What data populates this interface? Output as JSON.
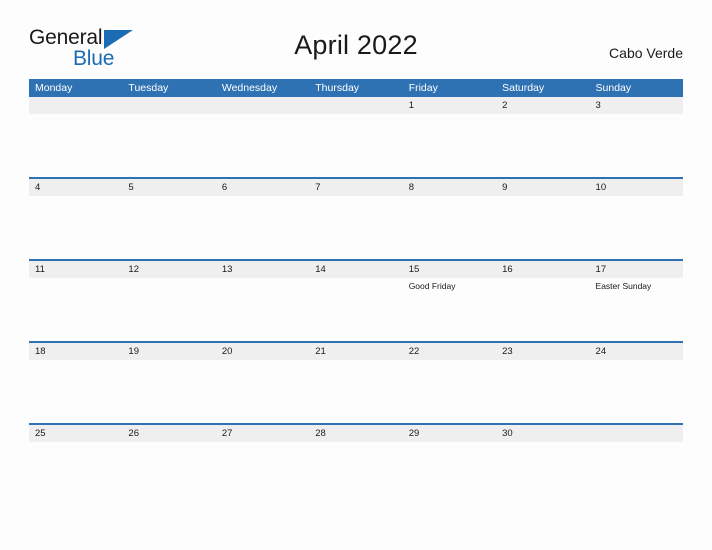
{
  "brand": {
    "name_part1": "General",
    "name_part2": "Blue",
    "triangle_icon": "triangle-icon"
  },
  "header": {
    "title": "April 2022",
    "country": "Cabo Verde"
  },
  "calendar": {
    "month": "April",
    "year": "2022",
    "accent_color": "#2e72b4",
    "band_color": "#efefef",
    "weekdays": [
      "Monday",
      "Tuesday",
      "Wednesday",
      "Thursday",
      "Friday",
      "Saturday",
      "Sunday"
    ],
    "weeks": [
      [
        {
          "date": "",
          "event": ""
        },
        {
          "date": "",
          "event": ""
        },
        {
          "date": "",
          "event": ""
        },
        {
          "date": "",
          "event": ""
        },
        {
          "date": "1",
          "event": ""
        },
        {
          "date": "2",
          "event": ""
        },
        {
          "date": "3",
          "event": ""
        }
      ],
      [
        {
          "date": "4",
          "event": ""
        },
        {
          "date": "5",
          "event": ""
        },
        {
          "date": "6",
          "event": ""
        },
        {
          "date": "7",
          "event": ""
        },
        {
          "date": "8",
          "event": ""
        },
        {
          "date": "9",
          "event": ""
        },
        {
          "date": "10",
          "event": ""
        }
      ],
      [
        {
          "date": "11",
          "event": ""
        },
        {
          "date": "12",
          "event": ""
        },
        {
          "date": "13",
          "event": ""
        },
        {
          "date": "14",
          "event": ""
        },
        {
          "date": "15",
          "event": "Good Friday"
        },
        {
          "date": "16",
          "event": ""
        },
        {
          "date": "17",
          "event": "Easter Sunday"
        }
      ],
      [
        {
          "date": "18",
          "event": ""
        },
        {
          "date": "19",
          "event": ""
        },
        {
          "date": "20",
          "event": ""
        },
        {
          "date": "21",
          "event": ""
        },
        {
          "date": "22",
          "event": ""
        },
        {
          "date": "23",
          "event": ""
        },
        {
          "date": "24",
          "event": ""
        }
      ],
      [
        {
          "date": "25",
          "event": ""
        },
        {
          "date": "26",
          "event": ""
        },
        {
          "date": "27",
          "event": ""
        },
        {
          "date": "28",
          "event": ""
        },
        {
          "date": "29",
          "event": ""
        },
        {
          "date": "30",
          "event": ""
        },
        {
          "date": "",
          "event": ""
        }
      ]
    ]
  }
}
